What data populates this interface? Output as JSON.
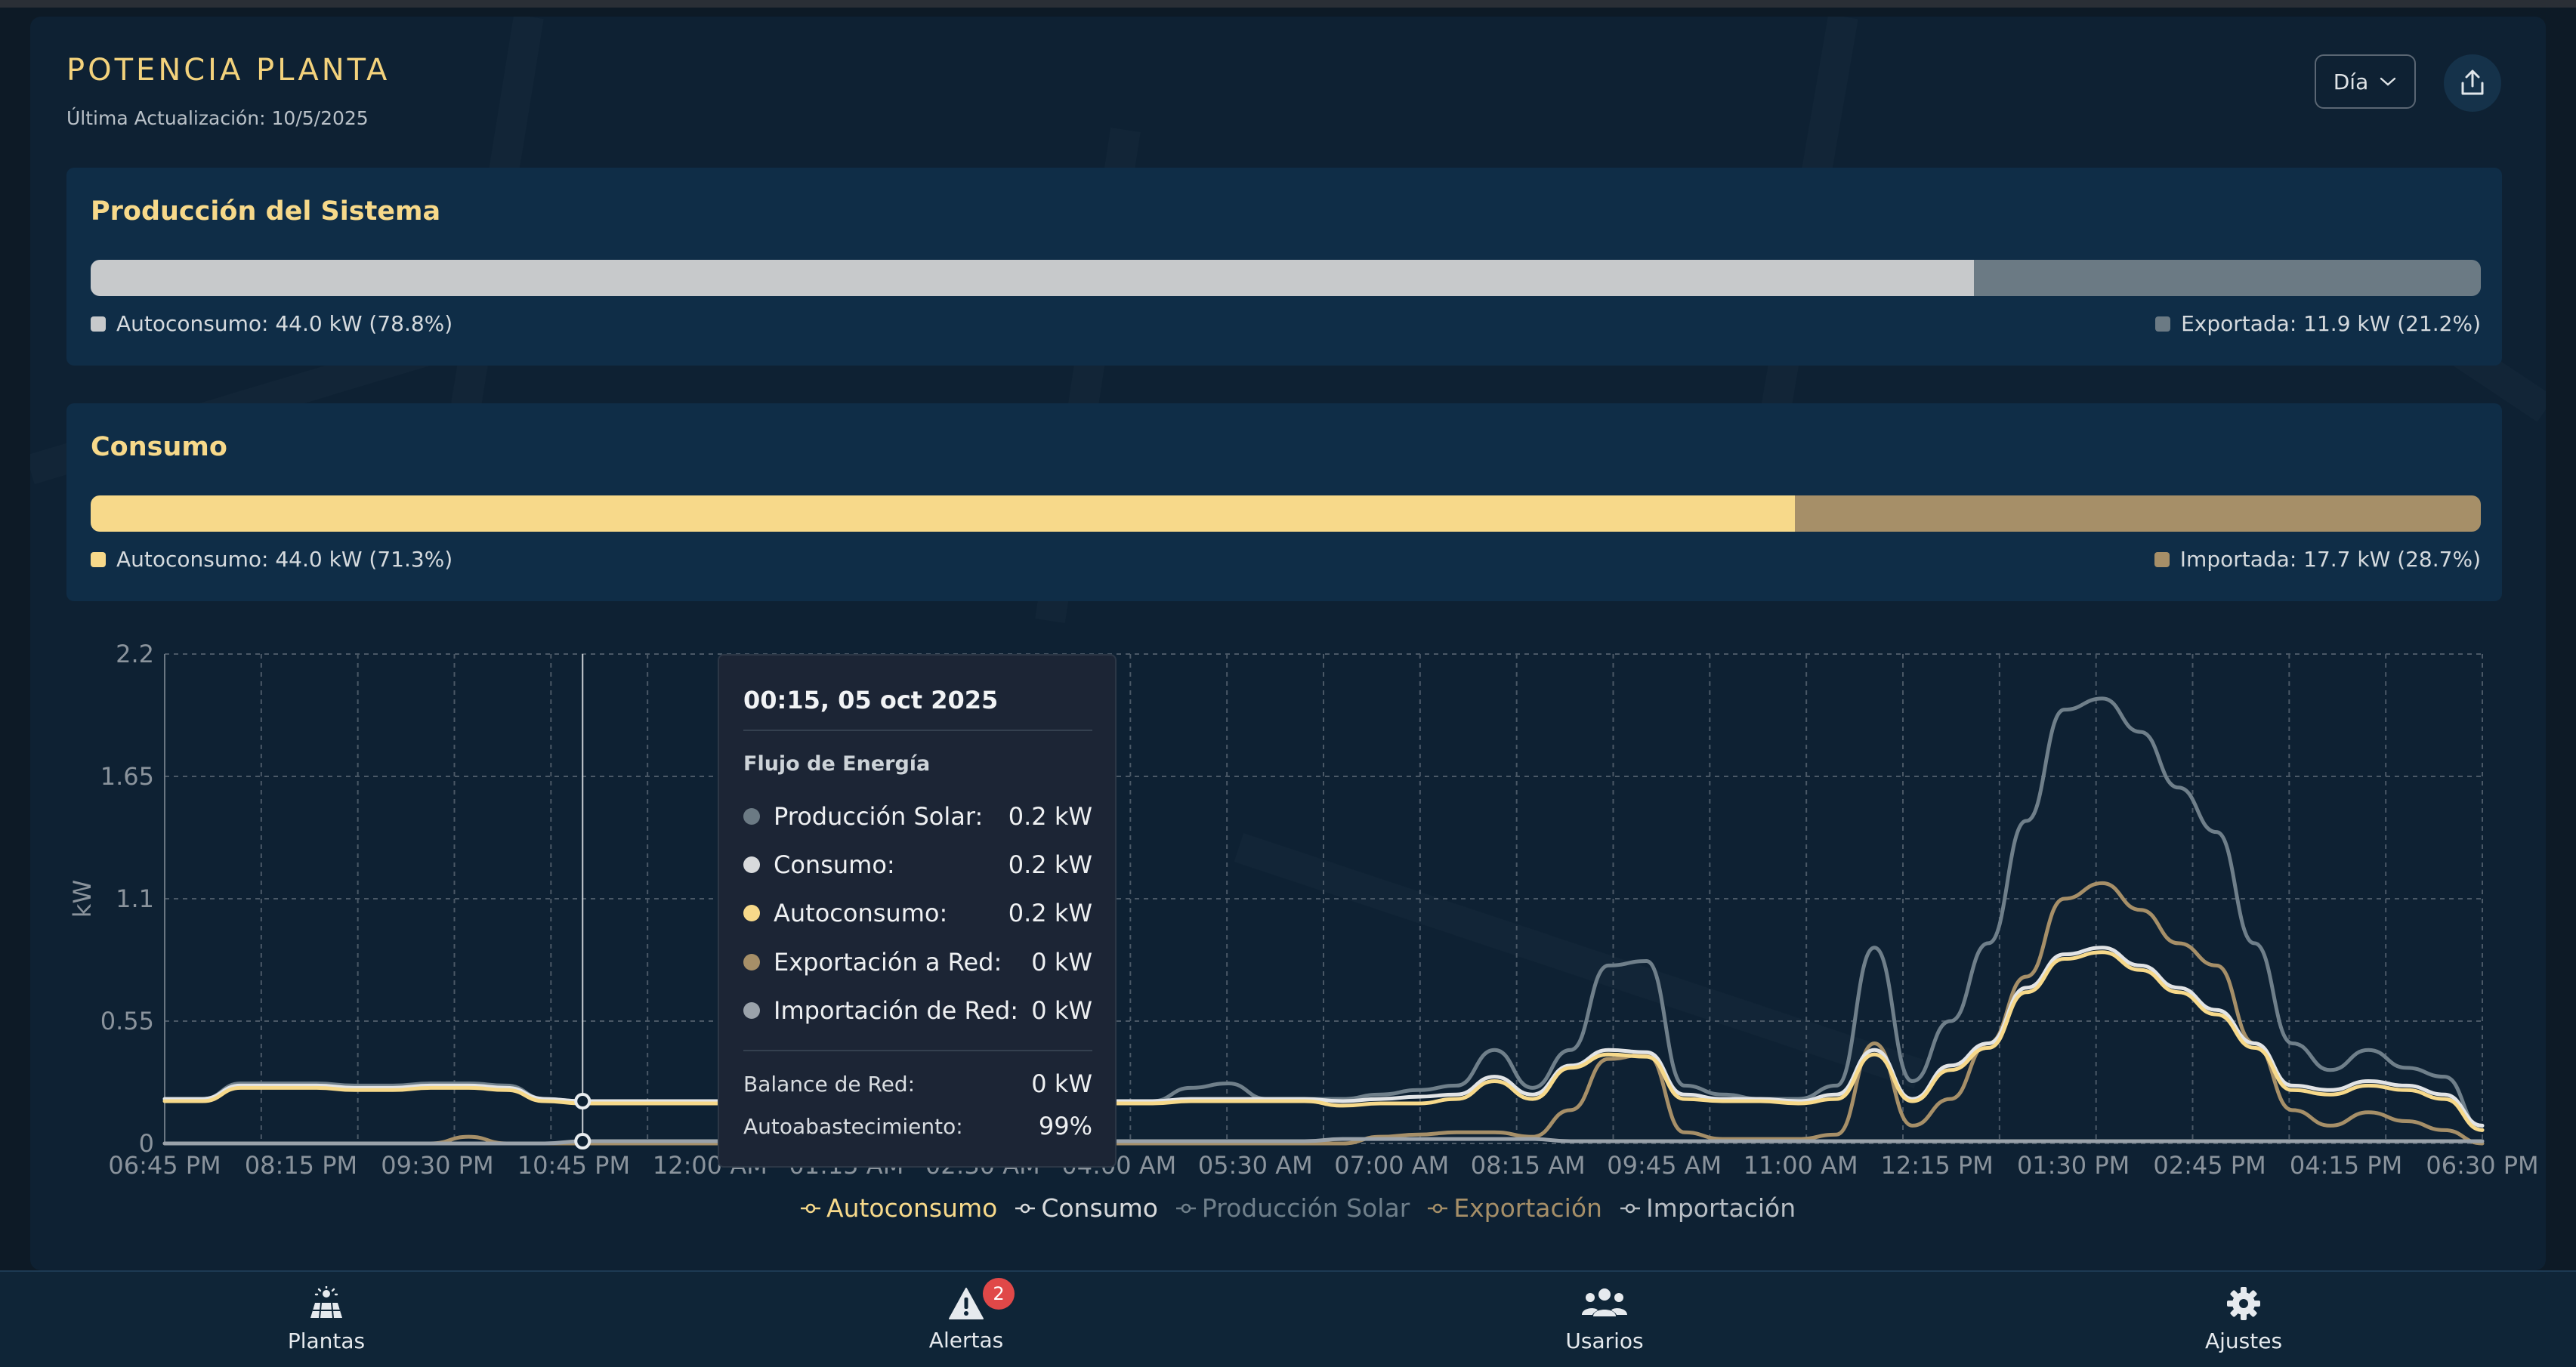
{
  "header": {
    "title": "POTENCIA PLANTA",
    "last_update": "Última Actualización: 10/5/2025",
    "range_select": "Día",
    "share_icon": "share-upload-icon"
  },
  "production_card": {
    "title": "Producción del Sistema",
    "self_consumption_fraction": 0.788,
    "self_label": "Autoconsumo: 44.0 kW (78.8%)",
    "other_label": "Exportada: 11.9 kW (21.2%)",
    "colors": {
      "self": "#c7c9cb",
      "other": "#6b7a84"
    }
  },
  "consumption_card": {
    "title": "Consumo",
    "self_consumption_fraction": 0.713,
    "self_label": "Autoconsumo: 44.0 kW (71.3%)",
    "other_label": "Importada: 17.7 kW (28.7%)",
    "colors": {
      "self": "#f7d98a",
      "other": "#a68f68"
    }
  },
  "tooltip": {
    "title": "00:15, 05 oct 2025",
    "section": "Flujo de Energía",
    "rows": [
      {
        "label": "Producción Solar:",
        "value": "0.2 kW",
        "color": "#6b7a84"
      },
      {
        "label": "Consumo:",
        "value": "0.2 kW",
        "color": "#d8dadc"
      },
      {
        "label": "Autoconsumo:",
        "value": "0.2 kW",
        "color": "#f7d98a"
      },
      {
        "label": "Exportación a Red:",
        "value": "0 kW",
        "color": "#a68f68"
      },
      {
        "label": "Importación de Red:",
        "value": "0 kW",
        "color": "#9aa2aa"
      }
    ],
    "balance": {
      "label": "Balance de Red:",
      "value": "0 kW"
    },
    "autarky": {
      "label": "Autoabastecimiento:",
      "value": "99%"
    }
  },
  "chart_data": {
    "type": "line",
    "ylabel": "kW",
    "ylim": [
      0,
      2.2
    ],
    "y_ticks": [
      "0",
      "0.55",
      "1.1",
      "1.65",
      "2.2"
    ],
    "x_tick_labels": [
      "06:45 PM",
      "08:15 PM",
      "09:30 PM",
      "10:45 PM",
      "12:00 AM",
      "01:15 AM",
      "02:30 AM",
      "04:00 AM",
      "05:30 AM",
      "07:00 AM",
      "08:15 AM",
      "09:45 AM",
      "11:00 AM",
      "12:15 PM",
      "01:30 PM",
      "02:45 PM",
      "04:15 PM",
      "06:30 PM"
    ],
    "x": [
      "06:45 PM",
      "07:15 PM",
      "07:45 PM",
      "08:15 PM",
      "08:45 PM",
      "09:15 PM",
      "09:45 PM",
      "10:15 PM",
      "10:45 PM",
      "11:15 PM",
      "11:45 PM",
      "12:15 AM",
      "12:45 AM",
      "01:15 AM",
      "01:45 AM",
      "02:15 AM",
      "02:45 AM",
      "03:15 AM",
      "03:45 AM",
      "04:15 AM",
      "04:45 AM",
      "05:15 AM",
      "05:45 AM",
      "06:15 AM",
      "06:45 AM",
      "07:15 AM",
      "07:45 AM",
      "08:15 AM",
      "08:45 AM",
      "09:15 AM",
      "09:45 AM",
      "10:15 AM",
      "10:45 AM",
      "11:15 AM",
      "11:45 AM",
      "12:00 PM",
      "12:15 PM",
      "12:30 PM",
      "12:45 PM",
      "01:00 PM",
      "01:15 PM",
      "01:30 PM",
      "01:45 PM",
      "02:00 PM",
      "02:15 PM",
      "02:30 PM",
      "02:45 PM",
      "03:00 PM",
      "03:15 PM",
      "03:30 PM",
      "03:45 PM",
      "04:00 PM",
      "04:15 PM",
      "04:30 PM",
      "04:45 PM",
      "05:00 PM",
      "05:15 PM",
      "05:30 PM",
      "05:45 PM",
      "06:00 PM",
      "06:15 PM",
      "06:30 PM"
    ],
    "series": [
      {
        "name": "Producción Solar",
        "color": "#6f7f8a",
        "values": [
          0.2,
          0.2,
          0.27,
          0.27,
          0.27,
          0.26,
          0.26,
          0.27,
          0.27,
          0.26,
          0.2,
          0.19,
          0.19,
          0.19,
          0.19,
          0.19,
          0.19,
          0.19,
          0.19,
          0.19,
          0.19,
          0.19,
          0.19,
          0.19,
          0.19,
          0.19,
          0.19,
          0.25,
          0.27,
          0.2,
          0.2,
          0.2,
          0.22,
          0.24,
          0.26,
          0.42,
          0.25,
          0.42,
          0.8,
          0.82,
          0.26,
          0.22,
          0.2,
          0.2,
          0.26,
          0.88,
          0.28,
          0.55,
          0.9,
          1.45,
          1.95,
          2.0,
          1.85,
          1.6,
          1.4,
          0.9,
          0.45,
          0.33,
          0.42,
          0.34,
          0.3,
          0.06
        ]
      },
      {
        "name": "Consumo",
        "color": "#e2e4e6",
        "values": [
          0.2,
          0.2,
          0.26,
          0.26,
          0.26,
          0.25,
          0.25,
          0.26,
          0.26,
          0.25,
          0.2,
          0.19,
          0.19,
          0.19,
          0.19,
          0.19,
          0.19,
          0.19,
          0.19,
          0.19,
          0.19,
          0.19,
          0.19,
          0.19,
          0.19,
          0.19,
          0.19,
          0.2,
          0.2,
          0.2,
          0.2,
          0.19,
          0.2,
          0.21,
          0.22,
          0.3,
          0.22,
          0.35,
          0.42,
          0.41,
          0.22,
          0.2,
          0.2,
          0.19,
          0.22,
          0.42,
          0.2,
          0.35,
          0.45,
          0.7,
          0.85,
          0.88,
          0.8,
          0.7,
          0.6,
          0.45,
          0.26,
          0.24,
          0.28,
          0.26,
          0.22,
          0.08
        ]
      },
      {
        "name": "Autoconsumo",
        "color": "#f7d98a",
        "values": [
          0.19,
          0.19,
          0.25,
          0.25,
          0.25,
          0.24,
          0.24,
          0.25,
          0.25,
          0.24,
          0.19,
          0.18,
          0.18,
          0.18,
          0.18,
          0.18,
          0.18,
          0.18,
          0.18,
          0.18,
          0.18,
          0.18,
          0.18,
          0.18,
          0.18,
          0.18,
          0.18,
          0.19,
          0.19,
          0.19,
          0.19,
          0.17,
          0.18,
          0.18,
          0.2,
          0.28,
          0.2,
          0.34,
          0.4,
          0.39,
          0.2,
          0.19,
          0.19,
          0.18,
          0.2,
          0.4,
          0.19,
          0.33,
          0.43,
          0.68,
          0.83,
          0.86,
          0.78,
          0.68,
          0.58,
          0.43,
          0.24,
          0.22,
          0.26,
          0.24,
          0.2,
          0.06
        ]
      },
      {
        "name": "Exportación",
        "color": "#a68f68",
        "values": [
          0,
          0,
          0,
          0,
          0,
          0,
          0,
          0,
          0.03,
          0,
          0,
          0,
          0,
          0,
          0,
          0,
          0,
          0,
          0,
          0,
          0,
          0,
          0,
          0,
          0,
          0,
          0,
          0,
          0,
          0,
          0,
          0,
          0.03,
          0.04,
          0.05,
          0.05,
          0.03,
          0.15,
          0.38,
          0.4,
          0.05,
          0.02,
          0.02,
          0.02,
          0.04,
          0.45,
          0.08,
          0.2,
          0.45,
          0.75,
          1.1,
          1.17,
          1.05,
          0.9,
          0.8,
          0.45,
          0.15,
          0.08,
          0.14,
          0.1,
          0.06,
          0.0
        ]
      },
      {
        "name": "Importación",
        "color": "#9aa2aa",
        "values": [
          0,
          0,
          0,
          0,
          0,
          0,
          0,
          0,
          0,
          0,
          0,
          0.01,
          0.01,
          0.01,
          0.01,
          0.01,
          0.01,
          0.01,
          0.01,
          0.01,
          0.01,
          0.01,
          0.01,
          0.01,
          0.01,
          0.01,
          0.01,
          0.01,
          0.01,
          0.01,
          0.01,
          0.02,
          0.02,
          0.02,
          0.02,
          0.02,
          0.02,
          0.01,
          0.01,
          0.01,
          0.01,
          0.01,
          0.01,
          0.01,
          0.01,
          0.01,
          0.01,
          0.01,
          0.01,
          0.01,
          0.01,
          0.01,
          0.01,
          0.01,
          0.01,
          0.01,
          0.01,
          0.01,
          0.01,
          0.01,
          0.01,
          0.01
        ]
      }
    ],
    "cursor_index": 11,
    "legend": [
      {
        "label": "Autoconsumo",
        "color": "#f7d98a"
      },
      {
        "label": "Consumo",
        "color": "#d8dadc"
      },
      {
        "label": "Producción Solar",
        "color": "#6f7f8a"
      },
      {
        "label": "Exportación",
        "color": "#a68f68"
      },
      {
        "label": "Importación",
        "color": "#b8bec4"
      }
    ],
    "grid": true
  },
  "nav": {
    "items": [
      {
        "label": "Plantas",
        "icon": "solar-plant-icon"
      },
      {
        "label": "Alertas",
        "icon": "alert-triangle-icon",
        "badge": "2"
      },
      {
        "label": "Usarios",
        "icon": "users-icon"
      },
      {
        "label": "Ajustes",
        "icon": "gear-icon"
      }
    ]
  }
}
